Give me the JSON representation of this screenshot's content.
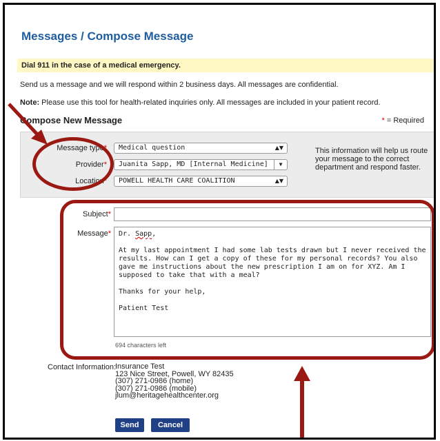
{
  "page": {
    "title": "Messages / Compose Message",
    "alert": "Dial 911 in the case of a medical emergency.",
    "intro": "Send us a message and we will respond within 2 business days. All messages are confidential.",
    "note_label": "Note:",
    "note_text": " Please use this tool for health-related inquiries only. All messages are included in your patient record.",
    "section_title": "Compose New Message",
    "required_star": "*",
    "required_legend": " = Required"
  },
  "form": {
    "message_type": {
      "label": "Message type",
      "value": "Medical question"
    },
    "provider": {
      "label": "Provider",
      "value": "Juanita Sapp, MD [Internal Medicine]"
    },
    "location": {
      "label": "Location",
      "value": "POWELL HEALTH CARE COALITION"
    },
    "help_text": "This information will help us route your message to the correct department and respond faster.",
    "subject": {
      "label": "Subject",
      "value": ""
    },
    "message": {
      "label": "Message",
      "greeting_prefix": "Dr. ",
      "greeting_name": "Sapp",
      "greeting_suffix": ",",
      "body": "At my last appointment I had some lab tests drawn but I never received the results. How can I get a copy of these for my personal records? You also gave me instructions about the new prescription I am on for XYZ. Am I supposed to take that with a meal?\n\nThanks for your help,\n\nPatient Test",
      "chars_left": "694 characters left"
    }
  },
  "contact": {
    "label": "Contact Information:",
    "name": "Insurance Test",
    "address": "123 Nice Street, Powell, WY 82435",
    "phone_home": "(307) 271-0986 (home)",
    "phone_mobile": "(307) 271-0986 (mobile)",
    "email": "jlum@heritagehealthcenter.org"
  },
  "buttons": {
    "send": "Send",
    "cancel": "Cancel"
  },
  "colors": {
    "title_blue": "#1f5d9e",
    "alert_yellow": "#fff8c4",
    "button_navy": "#1f3f87",
    "annotation_red": "#9a1a13",
    "required_red": "#d40000"
  }
}
